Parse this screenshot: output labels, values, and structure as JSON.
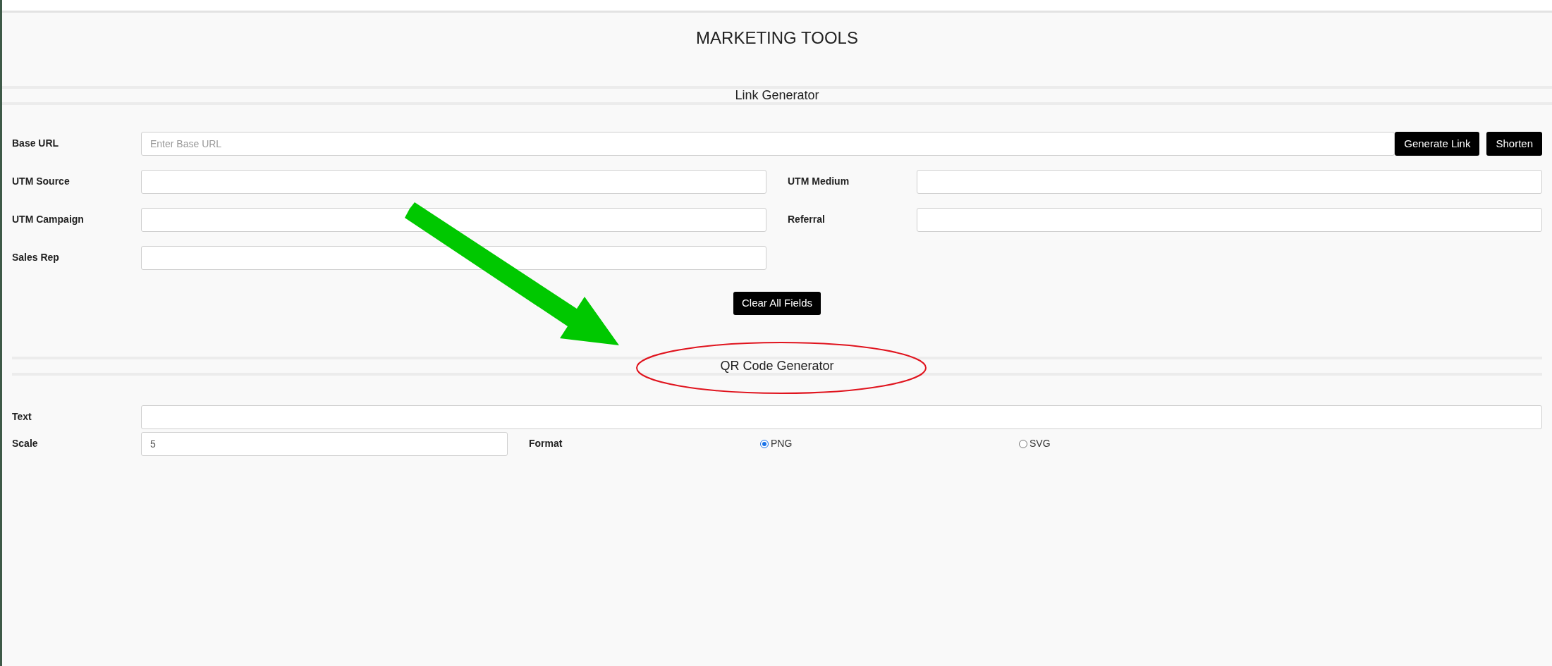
{
  "title": "MARKETING TOOLS",
  "link_generator": {
    "heading": "Link Generator",
    "base_url": {
      "label": "Base URL",
      "placeholder": "Enter Base URL"
    },
    "buttons": [
      "Generate Link",
      "Shorten"
    ],
    "fields": [
      {
        "label": "UTM Source"
      },
      {
        "label": "UTM Medium"
      },
      {
        "label": "UTM Campaign"
      },
      {
        "label": "Referral"
      },
      {
        "label": "Sales Rep"
      }
    ],
    "clear_button": "Clear All Fields"
  },
  "qr_generator": {
    "heading": "QR Code Generator",
    "text": {
      "label": "Text"
    },
    "scale": {
      "label": "Scale",
      "value": "5"
    },
    "format": {
      "label": "Format",
      "options": [
        {
          "label": "PNG",
          "selected": true
        },
        {
          "label": "SVG",
          "selected": false
        }
      ]
    }
  }
}
